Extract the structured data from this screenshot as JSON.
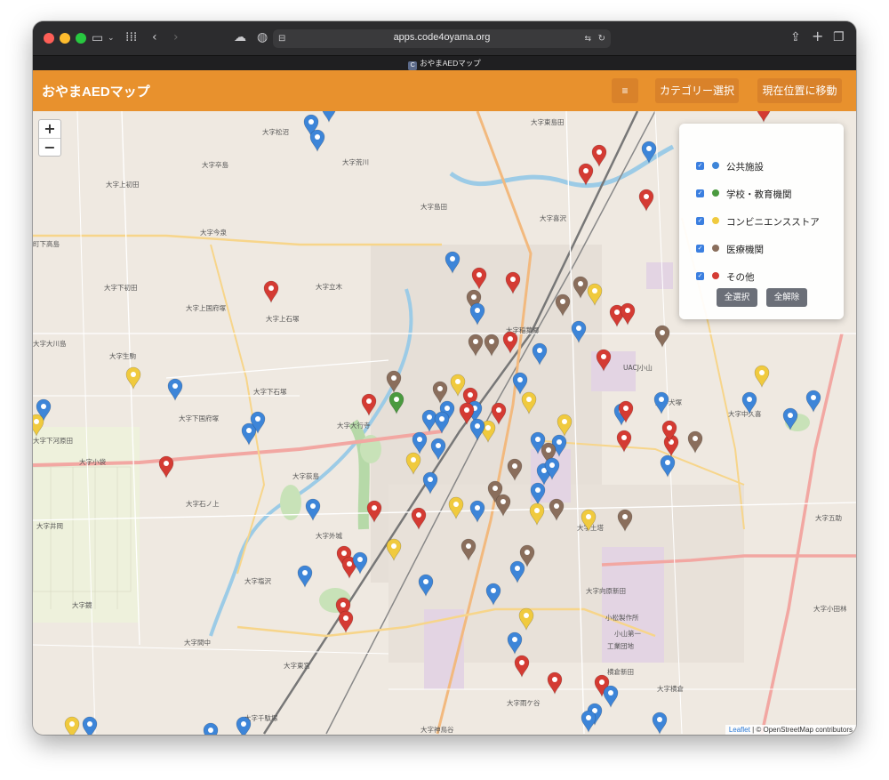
{
  "browser": {
    "url": "apps.code4oyama.org",
    "tab_title": "おやまAEDマップ",
    "tab_favicon": "C"
  },
  "app": {
    "title": "おやまAEDマップ",
    "menu_icon": "≡",
    "category_button": "カテゴリー選択",
    "locate_button": "現在位置に移動"
  },
  "map": {
    "zoom_in": "+",
    "zoom_out": "−",
    "attribution_leaflet": "Leaflet",
    "attribution_rest": "| © OpenStreetMap contributors",
    "place_labels": [
      "大字東島田",
      "大字松沼",
      "大字卒島",
      "大字荒川",
      "大字上初田",
      "大字今泉",
      "町下高島",
      "大字島田",
      "大字喜沢",
      "大字下初田",
      "大字上国府塚",
      "大字上石塚",
      "大字立木",
      "大字大川島",
      "大字生駒",
      "大字下石塚",
      "大字下国府塚",
      "大字大行寺",
      "大字小袋",
      "大字石ノ上",
      "大字荻島",
      "大字井岡",
      "大字外城",
      "大字塩沢",
      "大字鏡",
      "大字間中",
      "大字千駄塚",
      "大字神鳥谷",
      "大字雨ケ谷",
      "大字犬塚",
      "大字中久喜",
      "大字五助",
      "大字小田林",
      "大字横倉",
      "大字向原新田",
      "小松製作所 小山第一 工業団地",
      "大字土塔",
      "横倉新田",
      "大字下河原田",
      "大字稲葉郷",
      "UACJ小山"
    ]
  },
  "legend": {
    "items": [
      {
        "label": "公共施設",
        "color": "#3d85d8"
      },
      {
        "label": "学校・教育機関",
        "color": "#4a9a3f"
      },
      {
        "label": "コンビニエンスストア",
        "color": "#f0ca3e"
      },
      {
        "label": "医療機関",
        "color": "#8a6e5c"
      },
      {
        "label": "その他",
        "color": "#d43b33"
      }
    ],
    "select_all": "全選択",
    "deselect_all": "全解除",
    "checked_mark": "✓"
  }
}
